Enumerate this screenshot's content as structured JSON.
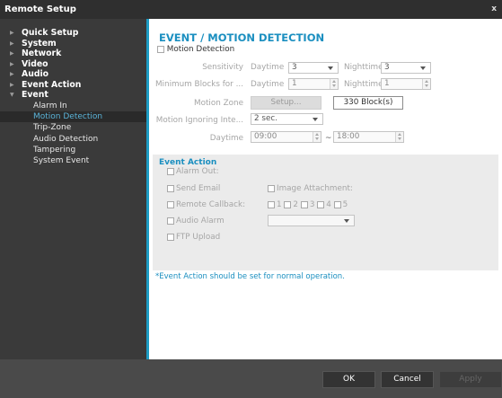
{
  "window": {
    "title": "Remote Setup",
    "close_label": "x"
  },
  "sidebar": {
    "top_items": [
      {
        "label": "Quick Setup"
      },
      {
        "label": "System"
      },
      {
        "label": "Network"
      },
      {
        "label": "Video"
      },
      {
        "label": "Audio"
      },
      {
        "label": "Event Action"
      },
      {
        "label": "Event"
      }
    ],
    "event_children": [
      {
        "label": "Alarm In"
      },
      {
        "label": "Motion Detection",
        "selected": true
      },
      {
        "label": "Trip-Zone"
      },
      {
        "label": "Audio Detection"
      },
      {
        "label": "Tampering"
      },
      {
        "label": "System Event"
      }
    ]
  },
  "main": {
    "title": "EVENT / MOTION DETECTION",
    "motion_detection_label": "Motion Detection",
    "sensitivity": {
      "label": "Sensitivity",
      "daytime_label": "Daytime",
      "daytime_value": "3",
      "nighttime_label": "Nighttime",
      "nighttime_value": "3"
    },
    "min_blocks": {
      "label": "Minimum Blocks for ...",
      "daytime_label": "Daytime",
      "daytime_value": "1",
      "nighttime_label": "Nighttime",
      "nighttime_value": "1"
    },
    "motion_zone": {
      "label": "Motion Zone",
      "setup_label": "Setup...",
      "blocks_label": "330 Block(s)"
    },
    "ignoring": {
      "label": "Motion Ignoring Inte...",
      "value": "2 sec."
    },
    "daytime": {
      "label": "Daytime",
      "start": "09:00",
      "separator": "~",
      "end": "18:00"
    }
  },
  "event_action": {
    "title": "Event Action",
    "alarm_out": "Alarm Out:",
    "send_email": "Send Email",
    "image_attachment": "Image Attachment:",
    "remote_callback": "Remote Callback:",
    "callback_numbers": [
      "1",
      "2",
      "3",
      "4",
      "5"
    ],
    "audio_alarm": "Audio Alarm",
    "audio_value": "",
    "ftp_upload": "FTP Upload",
    "note": "*Event Action should be set for normal operation."
  },
  "buttons": {
    "ok": "OK",
    "cancel": "Cancel",
    "apply": "Apply"
  }
}
